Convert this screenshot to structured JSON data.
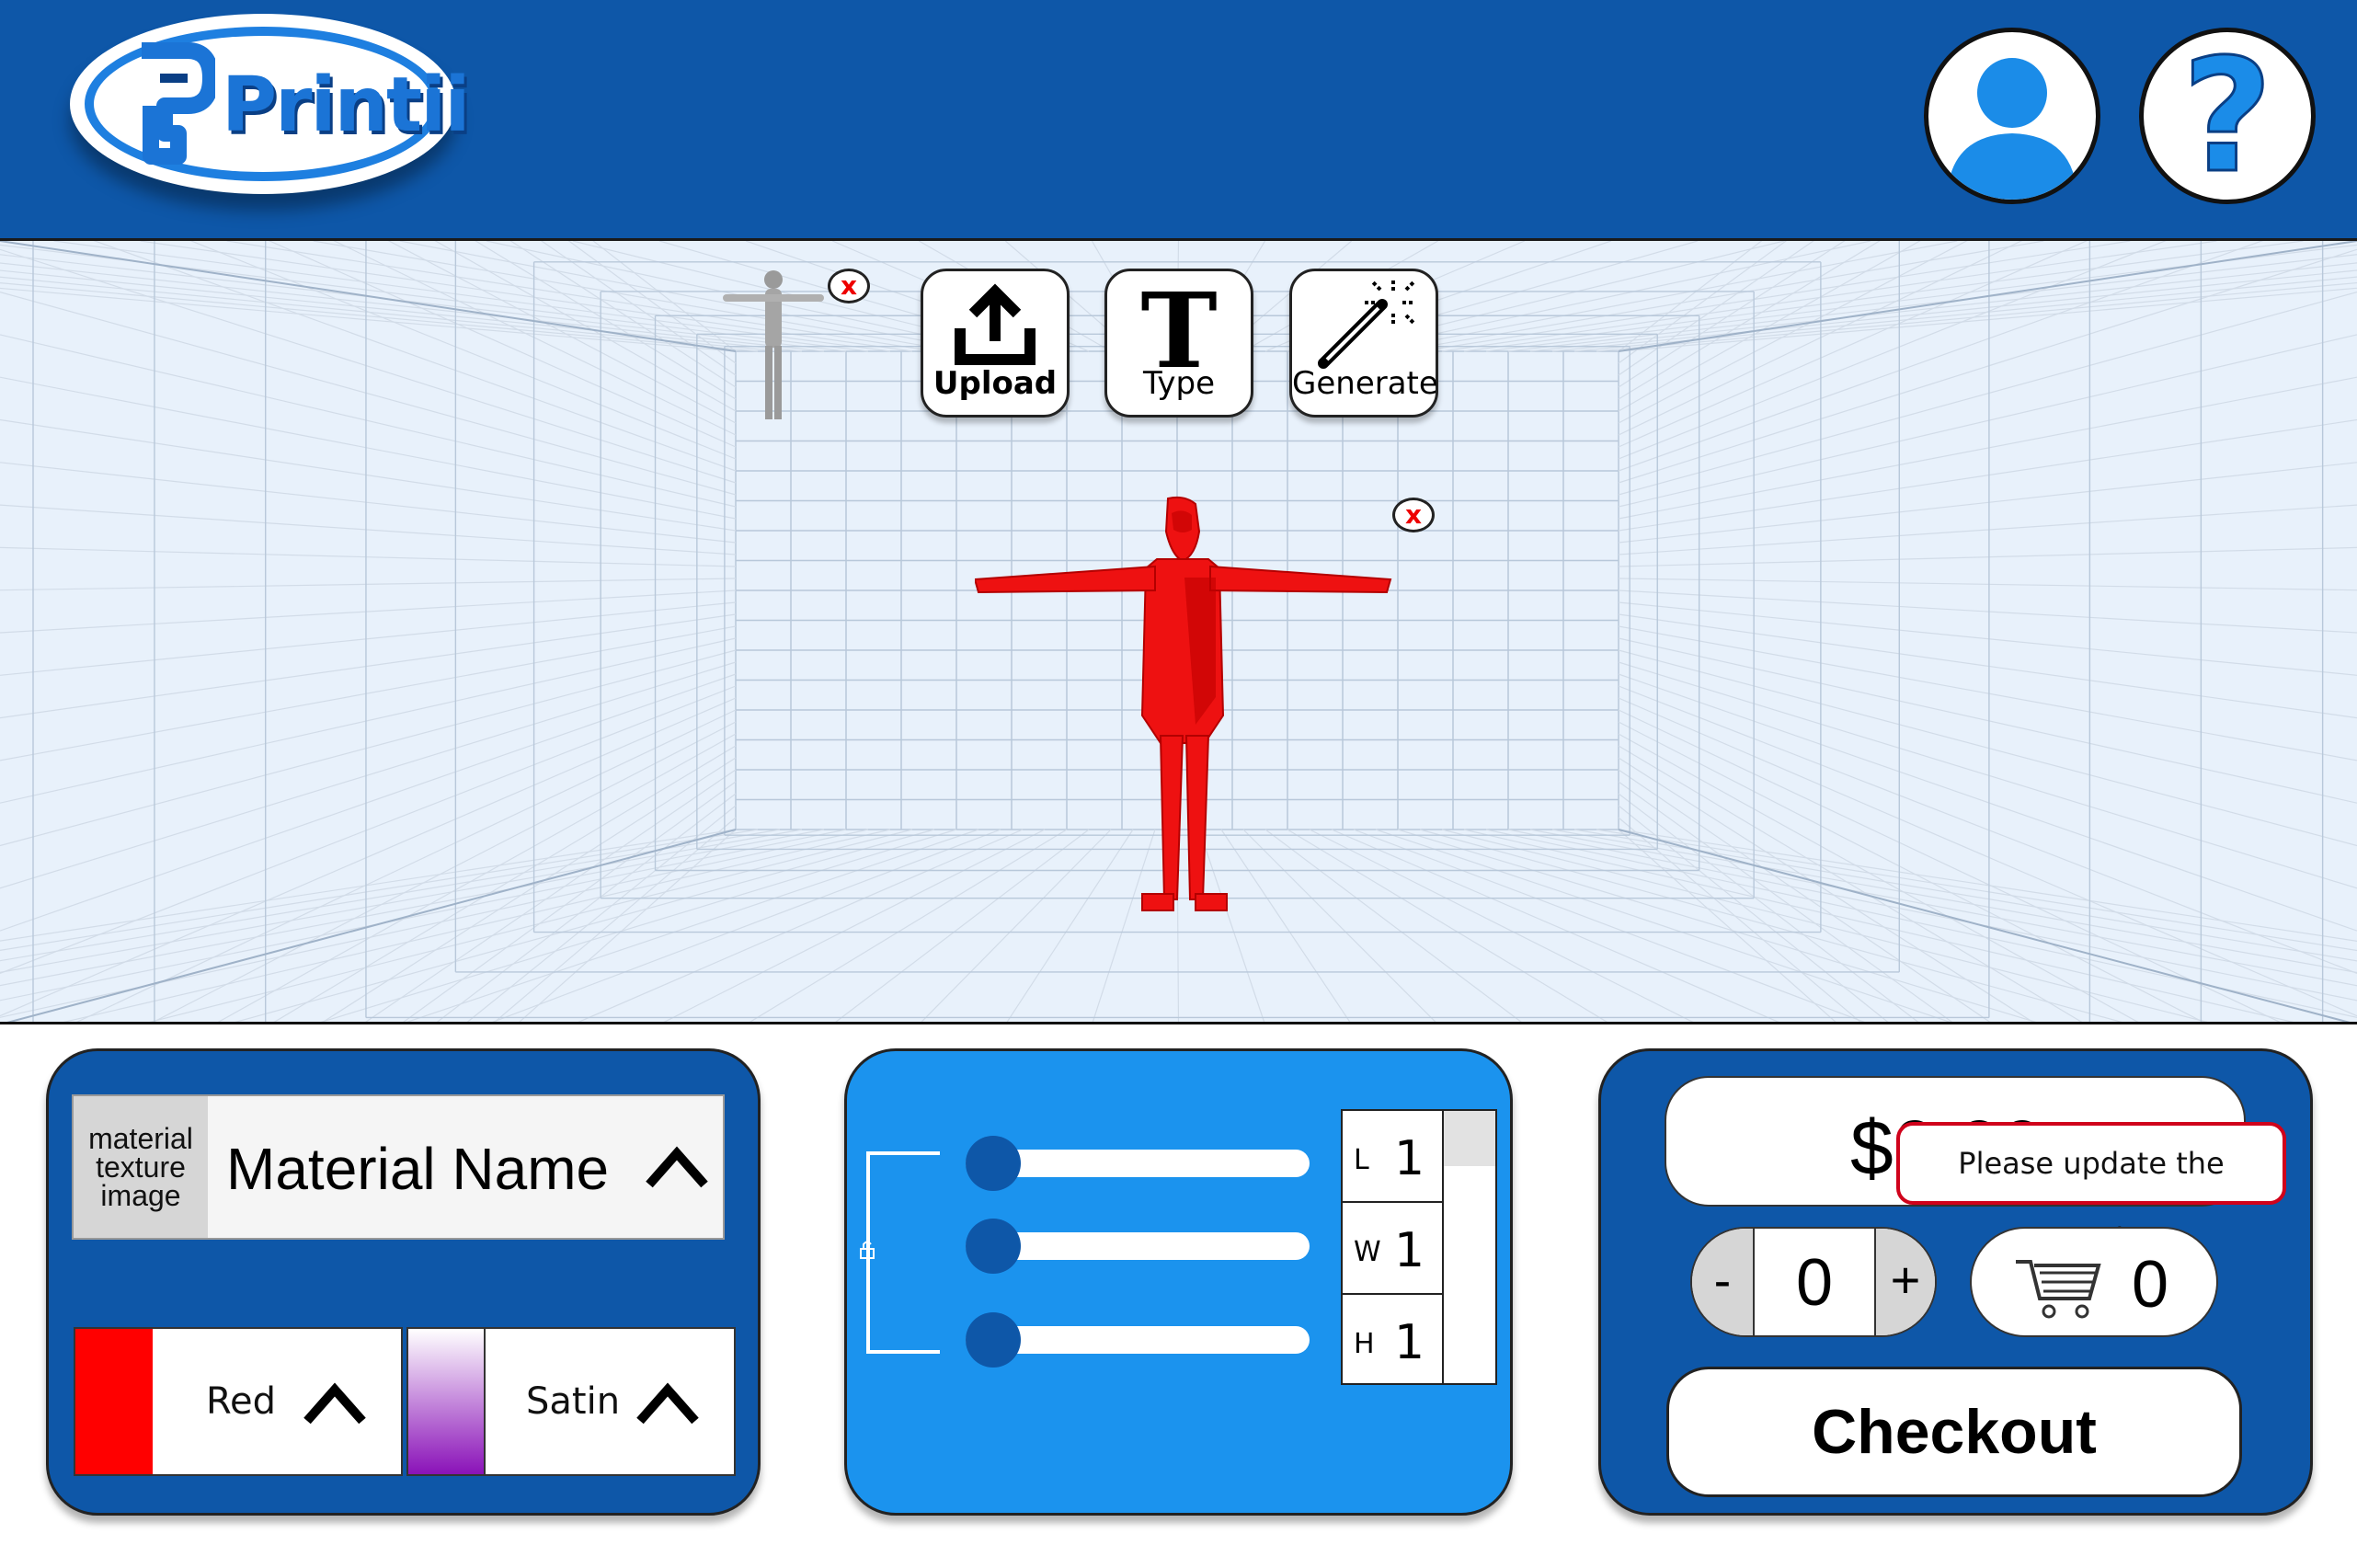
{
  "brand": {
    "name": "Printii",
    "primary_color": "#0e57a8",
    "accent_color": "#1b93ee"
  },
  "header": {
    "profile_icon": "user-icon",
    "help_icon": "question-mark-icon"
  },
  "toolbar": {
    "upload_label": "Upload",
    "type_label": "Type",
    "generate_label": "Generate"
  },
  "viewport": {
    "thumbnail_remove": "x",
    "model_remove": "x",
    "model_color": "#ee1111"
  },
  "material": {
    "texture_placeholder": "material texture image",
    "name": "Material Name",
    "color_name": "Red",
    "color_hex": "#ff0000",
    "finish_name": "Satin"
  },
  "dimensions": {
    "lock_icon": "lock-icon",
    "rows": [
      {
        "key": "L",
        "value": "1"
      },
      {
        "key": "W",
        "value": "1"
      },
      {
        "key": "H",
        "value": "1"
      }
    ]
  },
  "cart": {
    "price": "$0.00",
    "tooltip": "Please update the quantity",
    "qty_minus": "-",
    "qty_plus": "+",
    "quantity": "0",
    "cart_count": "0",
    "checkout_label": "Checkout"
  }
}
